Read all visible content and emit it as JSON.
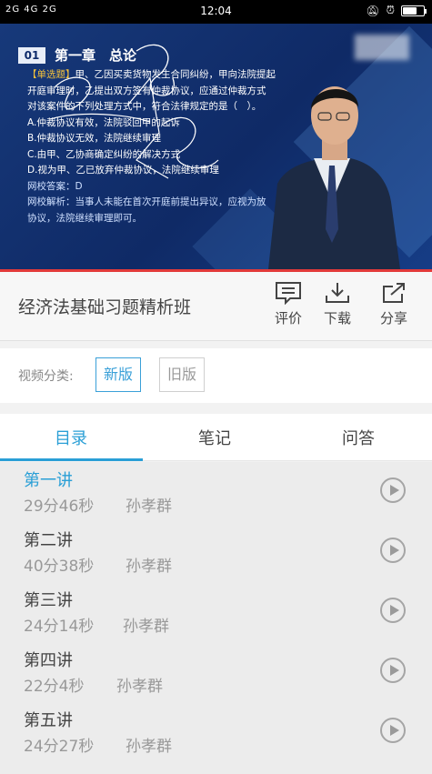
{
  "status_bar": {
    "signal": "2G 4G 2G",
    "time": "12:04"
  },
  "video": {
    "lesson_number": "01",
    "chapter_title": "第一章　总论",
    "question": {
      "tag": "【单选题】",
      "line1": "甲、乙因买卖货物发生合同纠纷，甲向法院提起",
      "line2": "开庭审理时，乙提出双方签有仲裁协议，应通过仲裁方式",
      "line3": "对该案件的下列处理方式中，符合法律规定的是（　）。",
      "options": [
        "A.仲裁协议有效，法院驳回甲的起诉",
        "B.仲裁协议无效，法院继续审理",
        "C.由甲、乙协商确定纠纷的解决方式",
        "D.视为甲、乙已放弃仲裁协议，法院继续审理"
      ],
      "answer": "网校答案：D",
      "analysis_line1": "网校解析：当事人未能在首次开庭前提出异议，应视为放",
      "analysis_line2": "协议，法院继续审理即可。"
    }
  },
  "course": {
    "title": "经济法基础习题精析班",
    "actions": {
      "review": "评价",
      "download": "下载",
      "share": "分享"
    }
  },
  "category": {
    "label": "视频分类:",
    "options": [
      "新版",
      "旧版"
    ],
    "selected": "新版"
  },
  "tabs": [
    "目录",
    "笔记",
    "问答"
  ],
  "lectures": [
    {
      "title": "第一讲",
      "duration": "29分46秒",
      "teacher": "孙孝群"
    },
    {
      "title": "第二讲",
      "duration": "40分38秒",
      "teacher": "孙孝群"
    },
    {
      "title": "第三讲",
      "duration": "24分14秒",
      "teacher": "孙孝群"
    },
    {
      "title": "第四讲",
      "duration": "22分4秒",
      "teacher": "孙孝群"
    },
    {
      "title": "第五讲",
      "duration": "24分27秒",
      "teacher": "孙孝群"
    }
  ],
  "colors": {
    "accent": "#2a9fd6",
    "video_bg": "#17397a",
    "progress": "#e23a3a"
  }
}
